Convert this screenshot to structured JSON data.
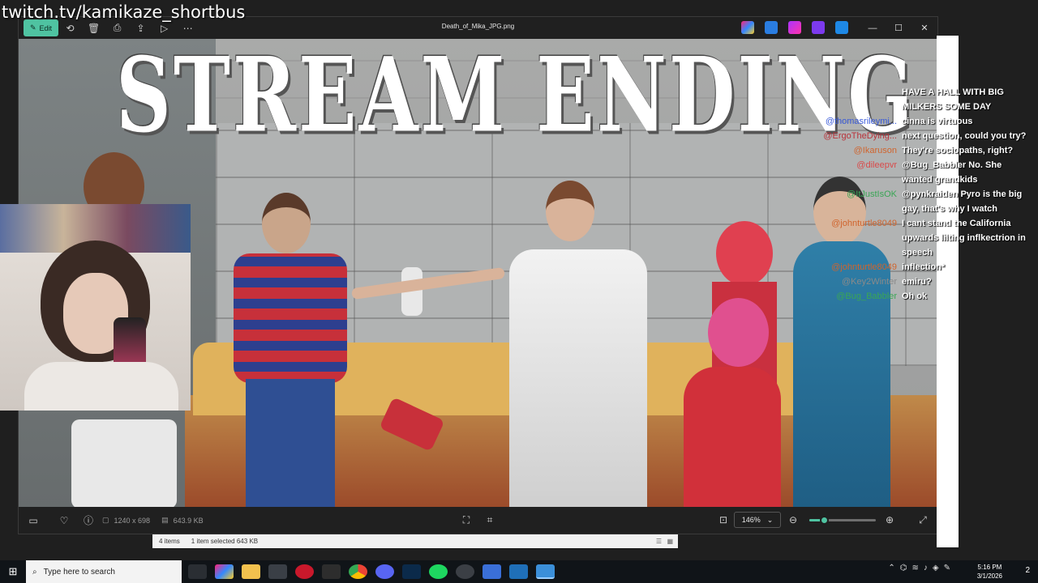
{
  "overlay": {
    "watermark": "twitch.tv/kamikaze_shortbus"
  },
  "viewer": {
    "title": "Death_of_Mika_JPG.png",
    "edit_label": "Edit",
    "image_headline": "STREAM ENDING",
    "dimensions": "1240 x 698",
    "file_size": "643.9 KB",
    "zoom": "146%",
    "zoom_fraction": 0.22
  },
  "chat": [
    {
      "user": "",
      "message": "HAVE A HALL WITH BIG",
      "color": "#ffffff"
    },
    {
      "user": "",
      "message": "MILKERS SOME DAY",
      "color": "#ffffff"
    },
    {
      "user": "@thomasrileymi...",
      "message": "cinna is virtuous",
      "color": "#3a5bd9"
    },
    {
      "user": "@ErgoTheDying...",
      "message": "next question, could you try?",
      "color": "#b8323a"
    },
    {
      "user": "@Ikaruson",
      "message": "They're sociopaths, right?",
      "color": "#d0642d"
    },
    {
      "user": "@dileepvr",
      "message": "@Bug_Babbler No. She",
      "color": "#d94a4a"
    },
    {
      "user": "",
      "message": "wanted grandkids",
      "color": "#ffffff"
    },
    {
      "user": "@ItJustIsOK",
      "message": "@pynkraiden Pyro is the big",
      "color": "#3aa655"
    },
    {
      "user": "",
      "message": "gay, that's why I watch",
      "color": "#ffffff"
    },
    {
      "user": "@johnturtle8049",
      "message": "I cant stand the California",
      "color": "#d0642d"
    },
    {
      "user": "",
      "message": "upwards lilting inflkectrion in",
      "color": "#ffffff"
    },
    {
      "user": "",
      "message": "speech",
      "color": "#ffffff"
    },
    {
      "user": "@johnturtle8049",
      "message": "inflection*",
      "color": "#d0642d"
    },
    {
      "user": "@Key2Winter",
      "message": "emiru?",
      "color": "#8a8a8a"
    },
    {
      "user": "@Bug_Babbler",
      "message": "Oh ok",
      "color": "#3aa655"
    }
  ],
  "explorer_status": {
    "items": "4 items",
    "selected": "1 item selected  643 KB"
  },
  "taskbar": {
    "search_placeholder": "Type here to search",
    "time": "5:16 PM",
    "date": "3/1/2026",
    "notification_count": "2"
  }
}
